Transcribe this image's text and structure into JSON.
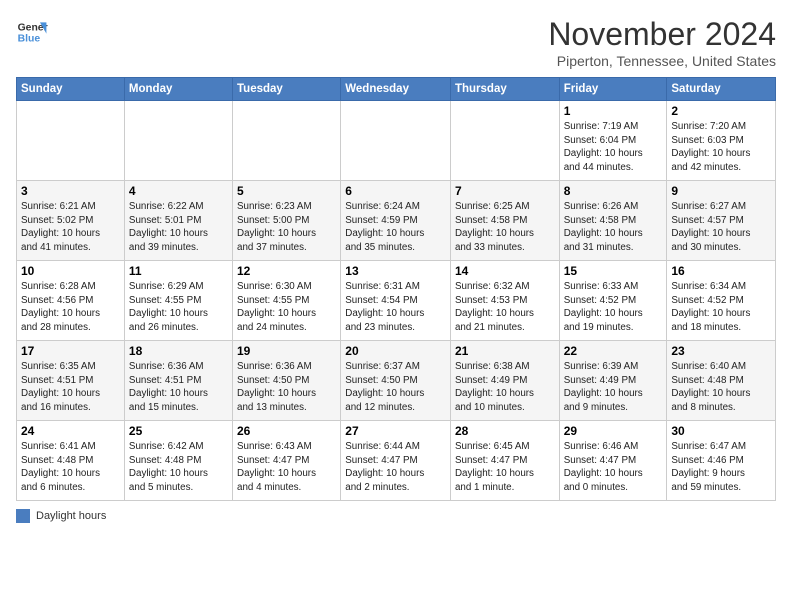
{
  "header": {
    "logo_line1": "General",
    "logo_line2": "Blue",
    "title": "November 2024",
    "subtitle": "Piperton, Tennessee, United States"
  },
  "days_of_week": [
    "Sunday",
    "Monday",
    "Tuesday",
    "Wednesday",
    "Thursday",
    "Friday",
    "Saturday"
  ],
  "legend_label": "Daylight hours",
  "weeks": [
    [
      {
        "day": "",
        "info": ""
      },
      {
        "day": "",
        "info": ""
      },
      {
        "day": "",
        "info": ""
      },
      {
        "day": "",
        "info": ""
      },
      {
        "day": "",
        "info": ""
      },
      {
        "day": "1",
        "info": "Sunrise: 7:19 AM\nSunset: 6:04 PM\nDaylight: 10 hours\nand 44 minutes."
      },
      {
        "day": "2",
        "info": "Sunrise: 7:20 AM\nSunset: 6:03 PM\nDaylight: 10 hours\nand 42 minutes."
      }
    ],
    [
      {
        "day": "3",
        "info": "Sunrise: 6:21 AM\nSunset: 5:02 PM\nDaylight: 10 hours\nand 41 minutes."
      },
      {
        "day": "4",
        "info": "Sunrise: 6:22 AM\nSunset: 5:01 PM\nDaylight: 10 hours\nand 39 minutes."
      },
      {
        "day": "5",
        "info": "Sunrise: 6:23 AM\nSunset: 5:00 PM\nDaylight: 10 hours\nand 37 minutes."
      },
      {
        "day": "6",
        "info": "Sunrise: 6:24 AM\nSunset: 4:59 PM\nDaylight: 10 hours\nand 35 minutes."
      },
      {
        "day": "7",
        "info": "Sunrise: 6:25 AM\nSunset: 4:58 PM\nDaylight: 10 hours\nand 33 minutes."
      },
      {
        "day": "8",
        "info": "Sunrise: 6:26 AM\nSunset: 4:58 PM\nDaylight: 10 hours\nand 31 minutes."
      },
      {
        "day": "9",
        "info": "Sunrise: 6:27 AM\nSunset: 4:57 PM\nDaylight: 10 hours\nand 30 minutes."
      }
    ],
    [
      {
        "day": "10",
        "info": "Sunrise: 6:28 AM\nSunset: 4:56 PM\nDaylight: 10 hours\nand 28 minutes."
      },
      {
        "day": "11",
        "info": "Sunrise: 6:29 AM\nSunset: 4:55 PM\nDaylight: 10 hours\nand 26 minutes."
      },
      {
        "day": "12",
        "info": "Sunrise: 6:30 AM\nSunset: 4:55 PM\nDaylight: 10 hours\nand 24 minutes."
      },
      {
        "day": "13",
        "info": "Sunrise: 6:31 AM\nSunset: 4:54 PM\nDaylight: 10 hours\nand 23 minutes."
      },
      {
        "day": "14",
        "info": "Sunrise: 6:32 AM\nSunset: 4:53 PM\nDaylight: 10 hours\nand 21 minutes."
      },
      {
        "day": "15",
        "info": "Sunrise: 6:33 AM\nSunset: 4:52 PM\nDaylight: 10 hours\nand 19 minutes."
      },
      {
        "day": "16",
        "info": "Sunrise: 6:34 AM\nSunset: 4:52 PM\nDaylight: 10 hours\nand 18 minutes."
      }
    ],
    [
      {
        "day": "17",
        "info": "Sunrise: 6:35 AM\nSunset: 4:51 PM\nDaylight: 10 hours\nand 16 minutes."
      },
      {
        "day": "18",
        "info": "Sunrise: 6:36 AM\nSunset: 4:51 PM\nDaylight: 10 hours\nand 15 minutes."
      },
      {
        "day": "19",
        "info": "Sunrise: 6:36 AM\nSunset: 4:50 PM\nDaylight: 10 hours\nand 13 minutes."
      },
      {
        "day": "20",
        "info": "Sunrise: 6:37 AM\nSunset: 4:50 PM\nDaylight: 10 hours\nand 12 minutes."
      },
      {
        "day": "21",
        "info": "Sunrise: 6:38 AM\nSunset: 4:49 PM\nDaylight: 10 hours\nand 10 minutes."
      },
      {
        "day": "22",
        "info": "Sunrise: 6:39 AM\nSunset: 4:49 PM\nDaylight: 10 hours\nand 9 minutes."
      },
      {
        "day": "23",
        "info": "Sunrise: 6:40 AM\nSunset: 4:48 PM\nDaylight: 10 hours\nand 8 minutes."
      }
    ],
    [
      {
        "day": "24",
        "info": "Sunrise: 6:41 AM\nSunset: 4:48 PM\nDaylight: 10 hours\nand 6 minutes."
      },
      {
        "day": "25",
        "info": "Sunrise: 6:42 AM\nSunset: 4:48 PM\nDaylight: 10 hours\nand 5 minutes."
      },
      {
        "day": "26",
        "info": "Sunrise: 6:43 AM\nSunset: 4:47 PM\nDaylight: 10 hours\nand 4 minutes."
      },
      {
        "day": "27",
        "info": "Sunrise: 6:44 AM\nSunset: 4:47 PM\nDaylight: 10 hours\nand 2 minutes."
      },
      {
        "day": "28",
        "info": "Sunrise: 6:45 AM\nSunset: 4:47 PM\nDaylight: 10 hours\nand 1 minute."
      },
      {
        "day": "29",
        "info": "Sunrise: 6:46 AM\nSunset: 4:47 PM\nDaylight: 10 hours\nand 0 minutes."
      },
      {
        "day": "30",
        "info": "Sunrise: 6:47 AM\nSunset: 4:46 PM\nDaylight: 9 hours\nand 59 minutes."
      }
    ]
  ]
}
